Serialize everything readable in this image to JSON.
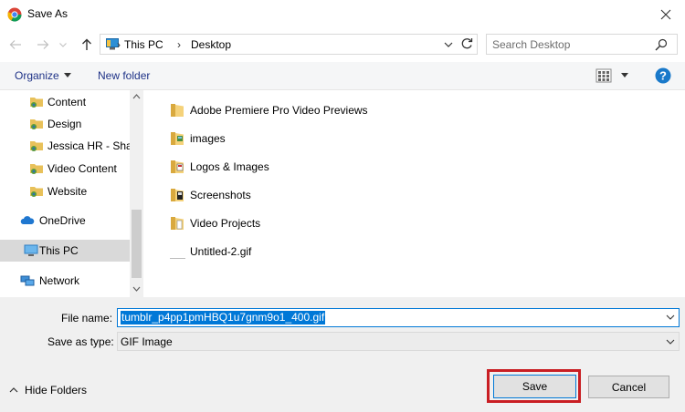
{
  "window": {
    "title": "Save As",
    "accent": "#0078d7"
  },
  "address": {
    "breadcrumbs": [
      "This PC",
      "Desktop"
    ],
    "search_placeholder": "Search Desktop"
  },
  "toolbar": {
    "organize": "Organize",
    "new_folder": "New folder"
  },
  "nav": {
    "items": [
      {
        "label": "Content",
        "icon": "shared-folder-icon"
      },
      {
        "label": "Design",
        "icon": "shared-folder-icon"
      },
      {
        "label": "Jessica HR - Shar",
        "icon": "shared-folder-icon"
      },
      {
        "label": "Video Content",
        "icon": "shared-folder-icon"
      },
      {
        "label": "Website",
        "icon": "shared-folder-icon"
      },
      {
        "label": "OneDrive",
        "icon": "cloud-icon"
      },
      {
        "label": "This PC",
        "icon": "computer-icon",
        "selected": true
      },
      {
        "label": "Network",
        "icon": "network-icon"
      }
    ]
  },
  "files": [
    {
      "name": "Adobe Premiere Pro Video Previews",
      "type": "folder"
    },
    {
      "name": "images",
      "type": "folder"
    },
    {
      "name": "Logos & Images",
      "type": "folder"
    },
    {
      "name": "Screenshots",
      "type": "folder"
    },
    {
      "name": "Video Projects",
      "type": "folder"
    },
    {
      "name": "Untitled-2.gif",
      "type": "file"
    }
  ],
  "form": {
    "file_name_label": "File name:",
    "file_name_value": "tumblr_p4pp1pmHBQ1u7gnm9o1_400.gif",
    "save_type_label": "Save as type:",
    "save_type_value": "GIF Image"
  },
  "footer": {
    "hide_folders": "Hide Folders",
    "save": "Save",
    "cancel": "Cancel",
    "highlight_color": "#c91e23"
  }
}
